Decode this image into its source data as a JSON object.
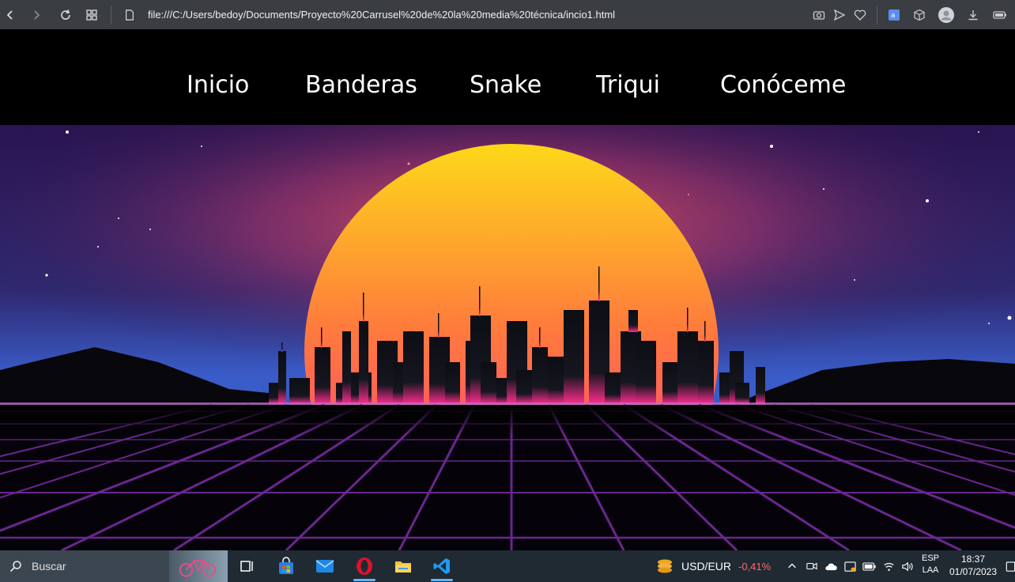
{
  "browser": {
    "url": "file:///C:/Users/bedoy/Documents/Proyecto%20Carrusel%20de%20la%20media%20técnica/incio1.html",
    "icons": [
      "back-icon",
      "forward-icon",
      "reload-icon",
      "tabs-grid-icon",
      "page-icon",
      "camera-icon",
      "send-icon",
      "heart-icon",
      "translate-icon",
      "cube-icon",
      "profile-icon",
      "download-icon",
      "battery-icon"
    ]
  },
  "nav": {
    "items": [
      {
        "label": "Inicio"
      },
      {
        "label": "Banderas"
      },
      {
        "label": "Snake"
      },
      {
        "label": "Triqui"
      },
      {
        "label": "Conóceme"
      }
    ]
  },
  "colors": {
    "sun_top": "#fdd819",
    "sun_mid": "#ff7a3d",
    "sun_bottom": "#ff2d8f",
    "sky_top": "#2a1450",
    "sky_horizon": "#3a5cc8",
    "grid_line": "#7a2a9a",
    "taskbar_bg": "#1f2a33",
    "accent_negative": "#ff6b6b"
  },
  "taskbar": {
    "search_placeholder": "Buscar",
    "apps": [
      "task-view-icon",
      "store-icon",
      "mail-icon",
      "opera-icon",
      "file-explorer-icon",
      "vscode-icon"
    ],
    "widget_label": "USD/EUR",
    "widget_value": "-0,41%",
    "lang_top": "ESP",
    "lang_bottom": "LAA",
    "time": "18:37",
    "date": "01/07/2023"
  }
}
